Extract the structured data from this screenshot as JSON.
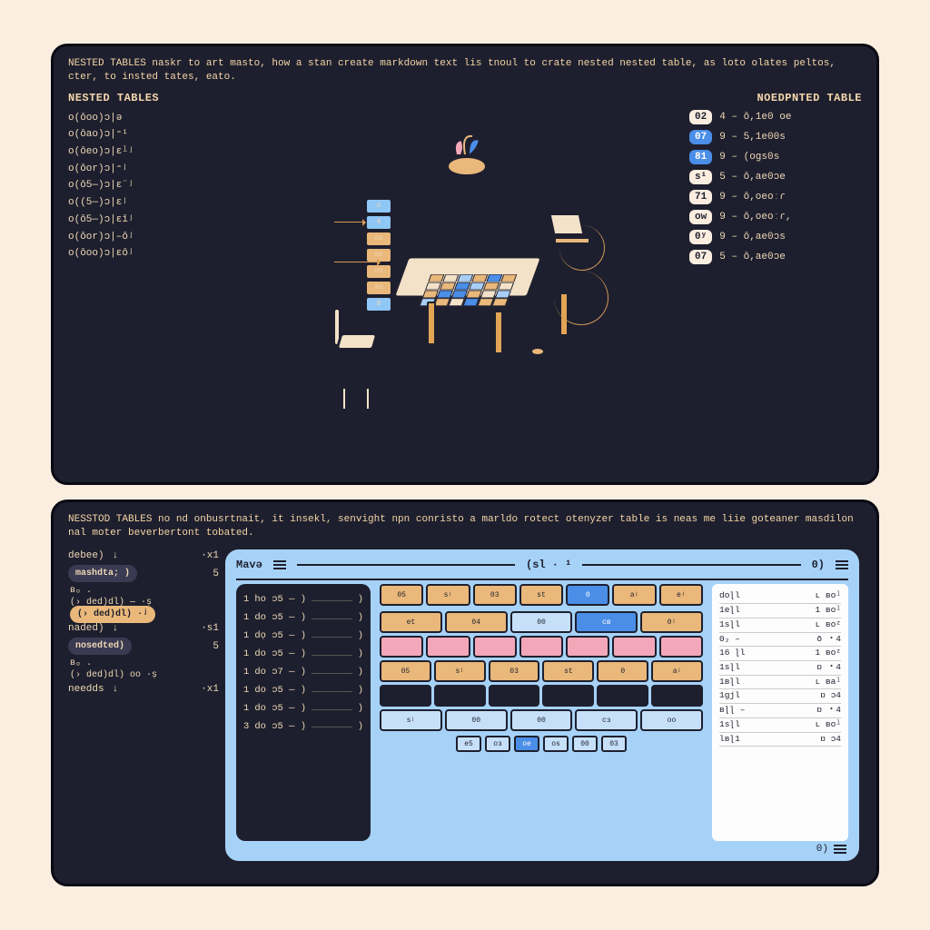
{
  "top": {
    "intro": "NESTED TABLES naskr to art masto, how a stan create markdown text lis tnoul to crate nested nested table, as loto olates peltos, cter, to insted tates, eato.",
    "left_title": "NESTED TABLES",
    "right_title": "NOEDPNTED TABLE",
    "left_rows": [
      "o(ōoo)ɔ|ə",
      "o(ōao)ɔ|⁼¹",
      "o(ōeo)ɔ|ɛˡʲ",
      "o(ōor)ɔ|⁼ʲ",
      "o(ō5—)ɔ|ɛ¨ʲ",
      "o((5—)ɔ|ɛʲ",
      "o(ō5—)ɔ|ɛīʲ",
      "o(ōor)ɔ|–ōʲ",
      "o(ōoo)ɔ|ɛōʲ"
    ],
    "chips": [
      "o",
      "4",
      "oo",
      "oo",
      "oo",
      "ao",
      "9"
    ],
    "right_rows": [
      {
        "k": "02",
        "v": "4 – ō,1e0 oe"
      },
      {
        "k": "07",
        "v": "9 – 5,1e00s"
      },
      {
        "k": "81",
        "v": "9 – (ogs0s"
      },
      {
        "k": "s¹",
        "v": "5 – ō,ae0ɔe"
      },
      {
        "k": "71",
        "v": "9 – ō,oeoːɾ"
      },
      {
        "k": "ow",
        "v": "9 – ō,oeoːɾ,"
      },
      {
        "k": "0ʸ",
        "v": "9 – ō,ae0ɔs"
      },
      {
        "k": "07",
        "v": "5 – ō,ae0ɔe"
      }
    ]
  },
  "bottom": {
    "intro": "NESSTOD TABLES no nd onbusrtnait, it insekl, senvight npn conristo a marldo rotect otenyzer table is neas me liie goteaner masdilon nal moter beverbertont tobated.",
    "flow": [
      {
        "type": "row",
        "l": "debee)",
        "r": "·x1"
      },
      {
        "type": "pill",
        "l": "mashdta; )",
        "r": "5"
      },
      {
        "type": "sub",
        "t": "ʙₒ ."
      },
      {
        "type": "sub",
        "t": "(› ded)dl) — ·ṣ"
      },
      {
        "type": "subhl",
        "t": "(› ded)dl) ·ʲ"
      },
      {
        "type": "row",
        "l": "naded)",
        "r": "·s1"
      },
      {
        "type": "pillbig",
        "l": "nosedted)",
        "r": "5"
      },
      {
        "type": "sub",
        "t": "ʙₒ ."
      },
      {
        "type": "sub",
        "t": "(› ded)dl) oo ·ṣ"
      },
      {
        "type": "row",
        "l": "needds",
        "r": "·x1"
      }
    ],
    "bar": {
      "l": "Mavə",
      "mid": "(sl · ¹",
      "r": "0)"
    },
    "numlist": [
      {
        "n": "1",
        "t": "ho ɔ5 — )"
      },
      {
        "n": "1",
        "t": "do ɔ5 — )"
      },
      {
        "n": "1",
        "t": "dọ ɔ5 — )"
      },
      {
        "n": "1",
        "t": "do ɔ5 — )"
      },
      {
        "n": "1",
        "t": "do ɔ7 — )"
      },
      {
        "n": "1",
        "t": "do ɔ5 — )"
      },
      {
        "n": "1",
        "t": "do ɔ5 — )"
      },
      {
        "n": "3",
        "t": "do ɔ5 — )"
      }
    ],
    "grid": [
      [
        "05",
        "sʲ",
        "03",
        "st",
        "0",
        "aʲ",
        "eʲ"
      ],
      [
        "-",
        "-",
        "-",
        "-",
        "-",
        "-",
        "-"
      ],
      [
        "et",
        "04",
        "00",
        "cв",
        "0ʲ",
        "-",
        "-"
      ],
      [
        "p",
        "p",
        "p",
        "p",
        "p",
        "p",
        "p"
      ],
      [
        "05",
        "sʲ",
        "03",
        "st",
        "0",
        "aʲ",
        "-"
      ],
      [
        "d",
        "d",
        "d",
        "d",
        "d",
        "d",
        "-"
      ],
      [
        "sʲ",
        "00",
        "00",
        "cз",
        "oo",
        "-",
        "-"
      ]
    ],
    "paging": [
      "e5",
      "oз",
      "oe",
      "os",
      "00",
      "03"
    ],
    "rightlist": [
      {
        "a": "doɭl",
        "b": "ʟ ʙoˡ"
      },
      {
        "a": "1eɭl",
        "b": "1 ʙoˡ"
      },
      {
        "a": "1sɭl",
        "b": "ʟ ʙoᶻ"
      },
      {
        "a": "0₂ –",
        "b": "ō ・4"
      },
      {
        "a": "16 ɭl",
        "b": "1 ʙoᶻ"
      },
      {
        "a": "1sɭl",
        "b": "ɒ ・4"
      },
      {
        "a": "1вɭl",
        "b": "ʟ ʙaˡ"
      },
      {
        "a": "1gjl",
        "b": "ɒ ɔ4"
      },
      {
        "a": "вɭɭ –",
        "b": "ɒ ・4"
      },
      {
        "a": "1sɭl",
        "b": "ʟ ʙoˡ"
      },
      {
        "a": "lвɭ1",
        "b": "ɒ ɔ4"
      }
    ],
    "foot": "0)"
  }
}
